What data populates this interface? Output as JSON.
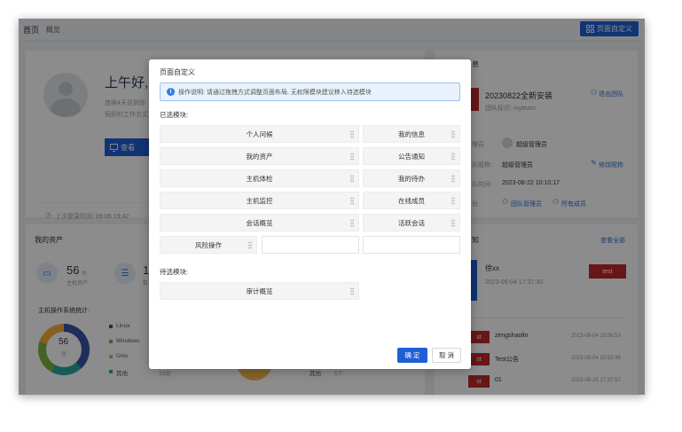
{
  "topbar": {
    "home": "首页",
    "overview": "概览",
    "customize_button": "页面自定义"
  },
  "welcome": {
    "greeting": "上午好,",
    "line1": "连续4天见到你",
    "line2": "祝好的工作方式",
    "view_button": "查看",
    "last_login": "上次登录时间: 09-06 19:42"
  },
  "team": {
    "title": "息",
    "name": "20230822全新安装",
    "identifier": "团队标识: myteam",
    "exit_link": "退出团队",
    "role_label": "理员",
    "role_value": "超级管理员",
    "nickname_label": "队昵称:",
    "nickname_value": "超级管理员",
    "edit_link": "修改昵称",
    "join_label": "队时间:",
    "join_value": "2023-08-22 10:10:17",
    "members_label": "份",
    "admins_link": "团队管理员",
    "all_members_link": "所有成员"
  },
  "assets": {
    "title": "我的资产",
    "host_count": "56",
    "host_unit": "台",
    "host_label": "主机资产",
    "second_count": "1",
    "second_label": "数",
    "os_stats_title": "主机操作系统统计:",
    "donut_total": "56",
    "donut_unit": "台",
    "legend": [
      "Linux",
      "Windows",
      "Unix",
      "其他"
    ],
    "legend_colors": [
      "#3a53a4",
      "#7cb342",
      "#f2b03c",
      "#2aa6a0"
    ],
    "other_count": "13台",
    "other2_label": "其他",
    "other2_count": "5个"
  },
  "notices": {
    "title": "知",
    "view_all": "查看全部",
    "feature_author": "徐xx",
    "feature_time": "2023-09-04 17:37:30",
    "feature_tag": "test",
    "items": [
      {
        "tag": "st",
        "title": "zengshaolin",
        "time": "2023-09-04 15:56:53"
      },
      {
        "tag": "st",
        "title": "Test公告",
        "time": "2023-09-04 15:52:49"
      },
      {
        "tag": "st",
        "title": "01",
        "time": "2023-08-25 17:37:57"
      }
    ]
  },
  "modal": {
    "title": "页面自定义",
    "info": "操作说明: 请通过拖拽方式调整页面布局, 无权限模块建议移入待选模块",
    "selected_label": "已选模块:",
    "candidate_label": "待选模块:",
    "selected": {
      "left": [
        "个人问候",
        "我的资产",
        "主机体检",
        "主机监控",
        "会话概览"
      ],
      "right": [
        "我的信息",
        "公告通知",
        "我的待办",
        "在线成员",
        "活跃会话"
      ],
      "small": "风险操作"
    },
    "candidates": [
      "审计概览"
    ],
    "ok": "确 定",
    "cancel": "取 消"
  }
}
